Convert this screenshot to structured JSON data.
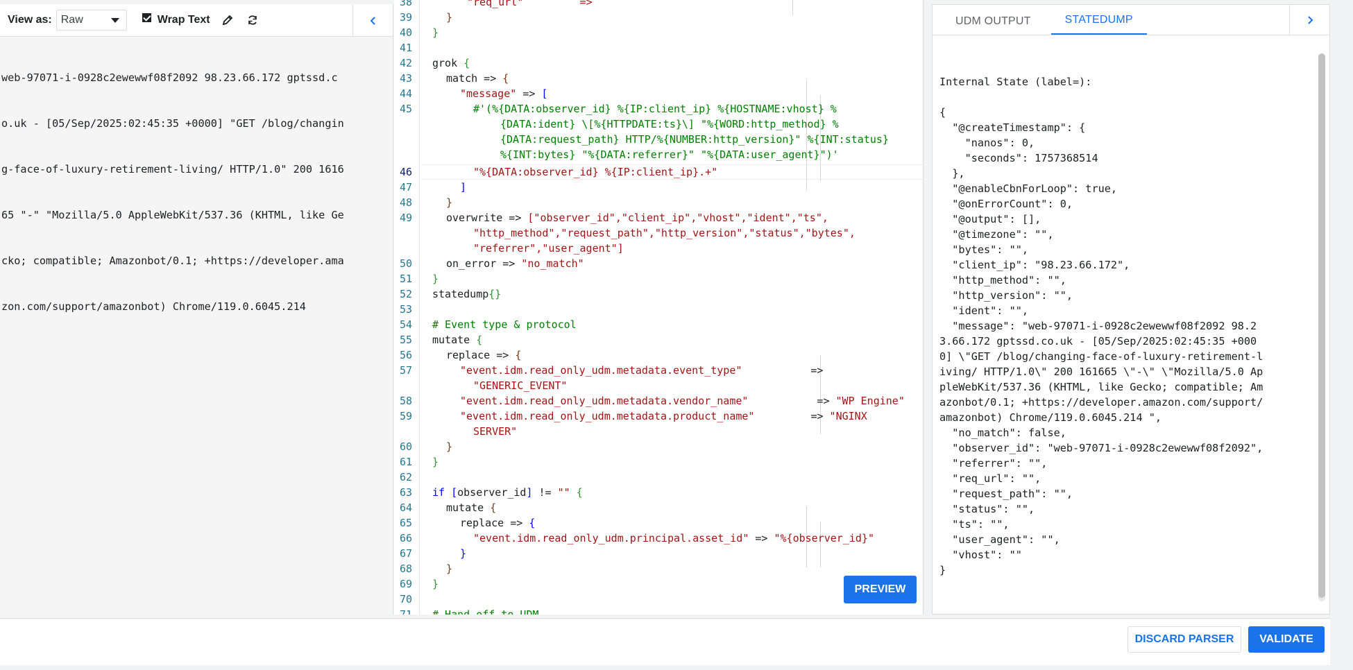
{
  "left_panel": {
    "view_as_label": "View as:",
    "view_as_value": "Raw",
    "wrap_text_label": "Wrap Text",
    "raw_lines": [
      "web-97071-i-0928c2ewewwf08f2092 98.23.66.172 gptssd.c",
      "o.uk - [05/Sep/2025:02:45:35 +0000] \"GET /blog/changin",
      "g-face-of-luxury-retirement-living/ HTTP/1.0\" 200 1616",
      "65 \"-\" \"Mozilla/5.0 AppleWebKit/537.36 (KHTML, like Ge",
      "cko; compatible; Amazonbot/0.1; +https://developer.ama",
      "zon.com/support/amazonbot) Chrome/119.0.6045.214"
    ]
  },
  "editor": {
    "line_numbers": [
      "38",
      "39",
      "40",
      "41",
      "42",
      "43",
      "44",
      "45",
      "46",
      "47",
      "48",
      "49",
      "50",
      "51",
      "52",
      "53",
      "54",
      "55",
      "56",
      "57",
      "58",
      "59",
      "60",
      "61",
      "62",
      "63",
      "64",
      "65",
      "66",
      "67",
      "68",
      "69",
      "70",
      "71"
    ],
    "code": {
      "l38": "\"req_url\"         =>",
      "l39": "}",
      "l40": "}",
      "l42_kw": "grok",
      "l42_brace": "{",
      "l43": "match =>",
      "l43_brace": "{",
      "l44_key": "\"message\"",
      "l44_op": "=>",
      "l44_brack": "[",
      "l45a": "#'(%{DATA:observer_id} %{IP:client_ip} %{HOSTNAME:vhost} %",
      "l45b": "{DATA:ident} \\[%{HTTPDATE:ts}\\] \"%{WORD:http_method} %",
      "l45c": "{DATA:request_path} HTTP/%{NUMBER:http_version}\" %{INT:status}",
      "l45d": "%{INT:bytes} \"%{DATA:referrer}\" \"%{DATA:user_agent}\")'",
      "l46": "\"%{DATA:observer_id} %{IP:client_ip}.+\"",
      "l47": "]",
      "l48": "}",
      "l49_key": "overwrite =>",
      "l49a": "[\"observer_id\",\"client_ip\",\"vhost\",\"ident\",\"ts\",",
      "l49b": "\"http_method\",\"request_path\",\"http_version\",\"status\",\"bytes\",",
      "l49c": "\"referrer\",\"user_agent\"]",
      "l50_key": "on_error =>",
      "l50_val": "\"no_match\"",
      "l51": "}",
      "l52_kw": "statedump",
      "l52_brace": "{}",
      "l54": "# Event type & protocol",
      "l55_kw": "mutate",
      "l55_brace": "{",
      "l56_key": "replace =>",
      "l56_brace": "{",
      "l57_key": "\"event.idm.read_only_udm.metadata.event_type\"",
      "l57_op": "=>",
      "l57_val": "\"GENERIC_EVENT\"",
      "l58_key": "\"event.idm.read_only_udm.metadata.vendor_name\"",
      "l58_op": "=>",
      "l58_val": "\"WP Engine\"",
      "l59_key": "\"event.idm.read_only_udm.metadata.product_name\"",
      "l59_op": "=>",
      "l59_val_a": "\"NGINX",
      "l59_val_b": "SERVER\"",
      "l60": "}",
      "l61": "}",
      "l63_kw": "if",
      "l63_a": "[",
      "l63_field": "observer_id",
      "l63_b": "]",
      "l63_op": "!=",
      "l63_val": "\"\"",
      "l63_brace": "{",
      "l64_kw": "mutate",
      "l64_brace": "{",
      "l65_key": "replace =>",
      "l65_brace": "{",
      "l66_key": "\"event.idm.read_only_udm.principal.asset_id\"",
      "l66_op": "=>",
      "l66_val": "\"%{observer_id}\"",
      "l67": "}",
      "l68": "}",
      "l69": "}",
      "l71": "# Hand-off to UDM"
    },
    "preview_label": "PREVIEW"
  },
  "right_panel": {
    "tabs": [
      "UDM OUTPUT",
      "STATEDUMP"
    ],
    "active_tab": "STATEDUMP",
    "dump_lines": [
      "Internal State (label=):",
      "",
      "{",
      "  \"@createTimestamp\": {",
      "    \"nanos\": 0,",
      "    \"seconds\": 1757368514",
      "  },",
      "  \"@enableCbnForLoop\": true,",
      "  \"@onErrorCount\": 0,",
      "  \"@output\": [],",
      "  \"@timezone\": \"\",",
      "  \"bytes\": \"\",",
      "  \"client_ip\": \"98.23.66.172\",",
      "  \"http_method\": \"\",",
      "  \"http_version\": \"\",",
      "  \"ident\": \"\",",
      "  \"message\": \"web-97071-i-0928c2ewewwf08f2092 98.2",
      "3.66.172 gptssd.co.uk - [05/Sep/2025:02:45:35 +000",
      "0] \\\"GET /blog/changing-face-of-luxury-retirement-l",
      "iving/ HTTP/1.0\\\" 200 161665 \\\"-\\\" \\\"Mozilla/5.0 Ap",
      "pleWebKit/537.36 (KHTML, like Gecko; compatible; Am",
      "azonbot/0.1; +https://developer.amazon.com/support/",
      "amazonbot) Chrome/119.0.6045.214 \",",
      "  \"no_match\": false,",
      "  \"observer_id\": \"web-97071-i-0928c2ewewwf08f2092\",",
      "  \"referrer\": \"\",",
      "  \"req_url\": \"\",",
      "  \"request_path\": \"\",",
      "  \"status\": \"\",",
      "  \"ts\": \"\",",
      "  \"user_agent\": \"\",",
      "  \"vhost\": \"\"",
      "}"
    ]
  },
  "footer": {
    "discard_label": "DISCARD PARSER",
    "validate_label": "VALIDATE"
  },
  "colors": {
    "accent": "#1a73e8",
    "string": "#a31515",
    "line_number": "#237893"
  }
}
